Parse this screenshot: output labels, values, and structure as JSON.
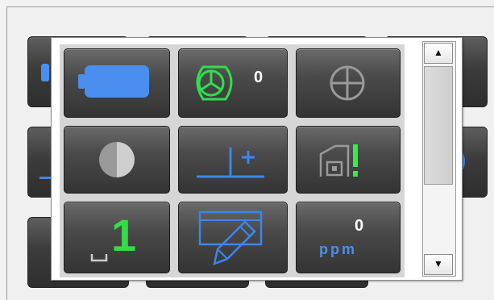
{
  "screen": {
    "background_color": "#f0f0f0"
  },
  "popup": {
    "tiles": [
      {
        "id": "battery",
        "icon": "battery-icon",
        "value": ""
      },
      {
        "id": "prism-constant",
        "icon": "prism-icon",
        "value": "0"
      },
      {
        "id": "target",
        "icon": "crosshair-icon",
        "value": ""
      },
      {
        "id": "illumination",
        "icon": "half-circle-icon",
        "value": ""
      },
      {
        "id": "tilt-correction",
        "icon": "tilt-icon",
        "value": ""
      },
      {
        "id": "signal",
        "icon": "signal-warning-icon",
        "value": ""
      },
      {
        "id": "space-mode",
        "icon": "space-one-icon",
        "value": "1"
      },
      {
        "id": "edit",
        "icon": "edit-pencil-icon",
        "value": ""
      },
      {
        "id": "ppm",
        "icon": "ppm-icon",
        "value": "0",
        "unit": "ppm"
      }
    ],
    "colors": {
      "battery": "#4a8ff0",
      "prism": "#2ee04a",
      "space_digit": "#33dd44",
      "blue_line": "#3a86f0",
      "warning": "#33ee44"
    }
  },
  "scrollbar": {
    "up_arrow": "▲",
    "down_arrow": "▼"
  }
}
